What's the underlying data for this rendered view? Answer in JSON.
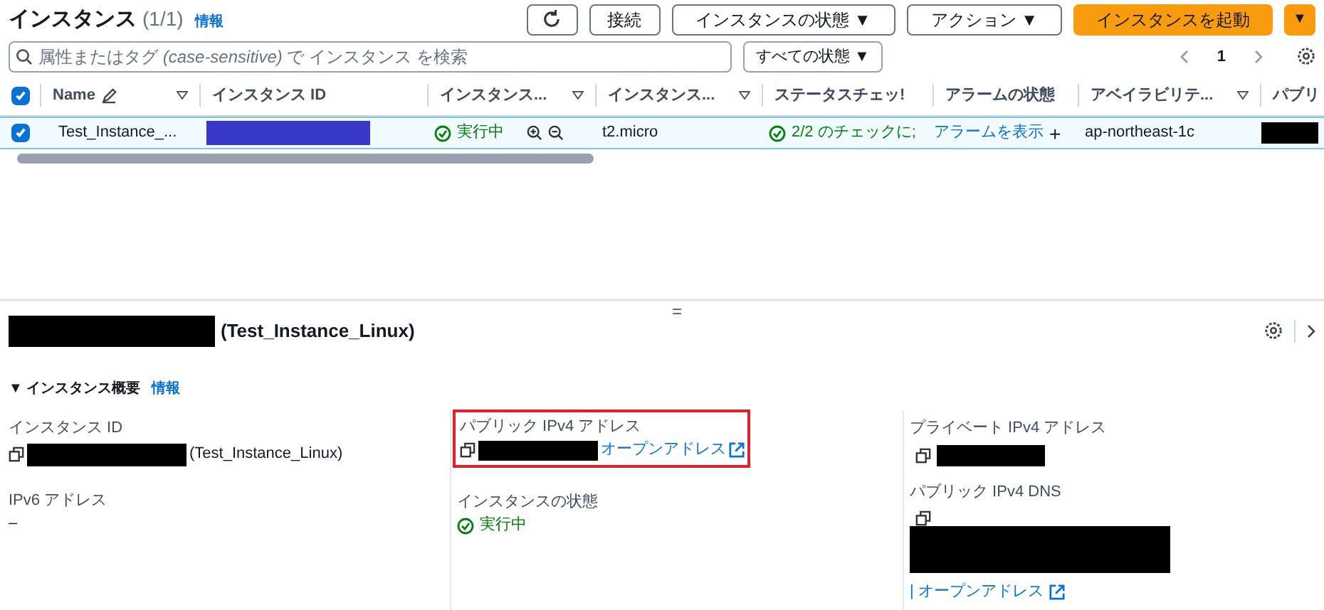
{
  "header": {
    "title": "インスタンス",
    "count": "(1/1)",
    "info": "情報",
    "buttons": [
      {
        "kind": "refresh"
      },
      {
        "kind": "text",
        "label": "接続"
      },
      {
        "kind": "dropdown",
        "label": "インスタンスの状態 ▼"
      },
      {
        "kind": "dropdown",
        "label": "アクション ▼"
      },
      {
        "kind": "primary",
        "label": "インスタンスを起動"
      },
      {
        "kind": "primary-caret",
        "label": "▼"
      }
    ]
  },
  "search": {
    "placeholder": "属性またはタグ *(case-sensitive)* で インスタンス を検索",
    "filter": "すべての状態 ▼",
    "page": "1"
  },
  "table": {
    "all_checked": true,
    "columns": [
      {
        "label": "Name",
        "edit": true,
        "filter": true
      },
      {
        "label": "インスタンス ID",
        "filter": false
      },
      {
        "label": "インスタンス...",
        "filter": true
      },
      {
        "label": "インスタンス...",
        "filter": true
      },
      {
        "label": "ステータスチェッ!",
        "filter": false
      },
      {
        "label": "アラームの状態",
        "filter": false
      },
      {
        "label": "アベイラビリテ...",
        "filter": true
      },
      {
        "label": "パブリ"
      }
    ],
    "rows": [
      {
        "checked": true,
        "selected": true,
        "name": "Test_Instance_...",
        "state": "実行中",
        "type": "t2.micro",
        "check": "2/2 のチェックに;",
        "alarm": "アラームを表示",
        "alarm_add": "+",
        "zone": "ap-northeast-1c"
      }
    ]
  },
  "detail": {
    "splitter": "=",
    "title": "(Test_Instance_Linux)",
    "section": {
      "title": "▼ インスタンス概要",
      "info": "情報"
    },
    "fields": [
      {
        "label": "インスタンス ID",
        "value": "(Test_Instance_Linux)"
      },
      {
        "label": "パブリック IPv4 アドレス",
        "link": "オープンアドレス",
        "highlighted": true
      },
      {
        "label": "プライベート IPv4 アドレス"
      },
      {
        "label": "IPv6 アドレス",
        "value": "–"
      },
      {
        "label": "インスタンスの状態",
        "state": "実行中"
      },
      {
        "label": "パブリック IPv4 DNS",
        "link": "| オープンアドレス"
      }
    ]
  }
}
